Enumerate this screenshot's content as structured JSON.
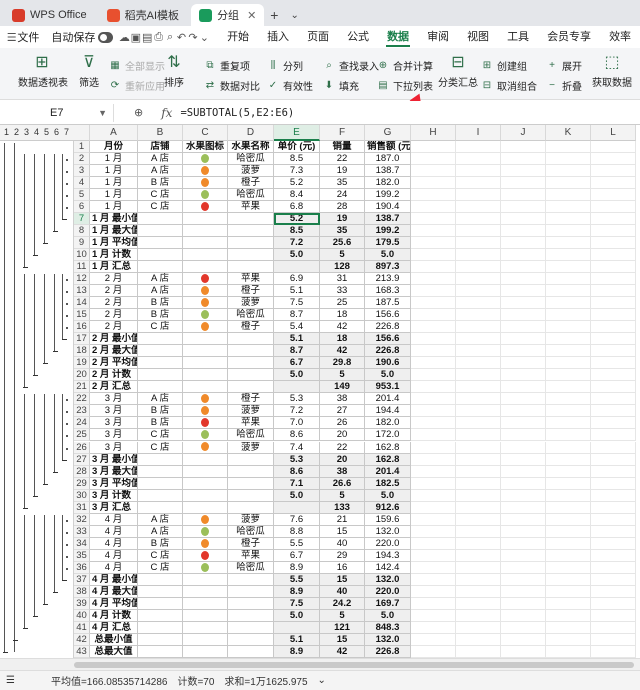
{
  "tabs": [
    {
      "label": "WPS Office",
      "color": "#d83b2a"
    },
    {
      "label": "稻壳AI模板",
      "color": "#e8502f"
    },
    {
      "label": "分组",
      "color": "#1a9b5c"
    }
  ],
  "menu": {
    "file": "文件",
    "autosave": "自动保存",
    "items": [
      "开始",
      "插入",
      "页面",
      "公式",
      "数据",
      "审阅",
      "视图",
      "工具",
      "会员专享",
      "效率"
    ],
    "active": "数据"
  },
  "ribbon": {
    "pivot": "数据透视表",
    "filter": "筛选",
    "show_all": "全部显示",
    "reapply": "重新应用",
    "sort": "排序",
    "duplicate": "重复项",
    "compare": "数据对比",
    "split": "分列",
    "validity": "有效性",
    "lookup": "查找录入",
    "fill": "填充",
    "consolidate": "合并计算",
    "dropdown": "下拉列表",
    "subtotal": "分类汇总",
    "group": "创建组",
    "ungroup": "取消组合",
    "expand": "展开",
    "collapse": "折叠",
    "get_data": "获取数据"
  },
  "formula_bar": {
    "cell": "E7",
    "fx": "fx",
    "formula": "=SUBTOTAL(5,E2:E6)"
  },
  "outline_levels": [
    "1",
    "2",
    "3",
    "4",
    "5",
    "6",
    "7"
  ],
  "columns": [
    "A",
    "B",
    "C",
    "D",
    "E",
    "F",
    "G",
    "H",
    "I",
    "J",
    "K",
    "L"
  ],
  "headers": [
    "月份",
    "店铺",
    "水果图标",
    "水果名称",
    "单价 (元)",
    "销量",
    "销售额 (元)"
  ],
  "rows": [
    {
      "n": "2",
      "type": "data",
      "a": "1 月",
      "b": "A 店",
      "fruit": "melon",
      "d": "哈密瓜",
      "e": "8.5",
      "f": "22",
      "g": "187.0"
    },
    {
      "n": "3",
      "type": "data",
      "a": "1 月",
      "b": "A 店",
      "fruit": "orange",
      "d": "菠萝",
      "e": "7.3",
      "f": "19",
      "g": "138.7"
    },
    {
      "n": "4",
      "type": "data",
      "a": "1 月",
      "b": "B 店",
      "fruit": "orange",
      "d": "橙子",
      "e": "5.2",
      "f": "35",
      "g": "182.0"
    },
    {
      "n": "5",
      "type": "data",
      "a": "1 月",
      "b": "C 店",
      "fruit": "melon",
      "d": "哈密瓜",
      "e": "8.4",
      "f": "24",
      "g": "199.2"
    },
    {
      "n": "6",
      "type": "data",
      "a": "1 月",
      "b": "C 店",
      "fruit": "apple",
      "d": "苹果",
      "e": "6.8",
      "f": "28",
      "g": "190.4"
    },
    {
      "n": "7",
      "type": "sum",
      "a": "1 月 最小值",
      "e": "5.2",
      "f": "19",
      "g": "138.7"
    },
    {
      "n": "8",
      "type": "sum",
      "a": "1 月 最大值",
      "e": "8.5",
      "f": "35",
      "g": "199.2"
    },
    {
      "n": "9",
      "type": "sum",
      "a": "1 月 平均值",
      "e": "7.2",
      "f": "25.6",
      "g": "179.5"
    },
    {
      "n": "10",
      "type": "sum",
      "a": "1 月 计数",
      "e": "5.0",
      "f": "5",
      "g": "5.0"
    },
    {
      "n": "11",
      "type": "sum",
      "a": "1 月 汇总",
      "e": "",
      "f": "128",
      "g": "897.3"
    },
    {
      "n": "12",
      "type": "data",
      "a": "2 月",
      "b": "A 店",
      "fruit": "apple",
      "d": "苹果",
      "e": "6.9",
      "f": "31",
      "g": "213.9"
    },
    {
      "n": "13",
      "type": "data",
      "a": "2 月",
      "b": "A 店",
      "fruit": "orange",
      "d": "橙子",
      "e": "5.1",
      "f": "33",
      "g": "168.3"
    },
    {
      "n": "14",
      "type": "data",
      "a": "2 月",
      "b": "B 店",
      "fruit": "orange",
      "d": "菠萝",
      "e": "7.5",
      "f": "25",
      "g": "187.5"
    },
    {
      "n": "15",
      "type": "data",
      "a": "2 月",
      "b": "B 店",
      "fruit": "melon",
      "d": "哈密瓜",
      "e": "8.7",
      "f": "18",
      "g": "156.6"
    },
    {
      "n": "16",
      "type": "data",
      "a": "2 月",
      "b": "C 店",
      "fruit": "orange",
      "d": "橙子",
      "e": "5.4",
      "f": "42",
      "g": "226.8"
    },
    {
      "n": "17",
      "type": "sum",
      "a": "2 月 最小值",
      "e": "5.1",
      "f": "18",
      "g": "156.6"
    },
    {
      "n": "18",
      "type": "sum",
      "a": "2 月 最大值",
      "e": "8.7",
      "f": "42",
      "g": "226.8"
    },
    {
      "n": "19",
      "type": "sum",
      "a": "2 月 平均值",
      "e": "6.7",
      "f": "29.8",
      "g": "190.6"
    },
    {
      "n": "20",
      "type": "sum",
      "a": "2 月 计数",
      "e": "5.0",
      "f": "5",
      "g": "5.0"
    },
    {
      "n": "21",
      "type": "sum",
      "a": "2 月 汇总",
      "e": "",
      "f": "149",
      "g": "953.1"
    },
    {
      "n": "22",
      "type": "data",
      "a": "3 月",
      "b": "A 店",
      "fruit": "orange",
      "d": "橙子",
      "e": "5.3",
      "f": "38",
      "g": "201.4"
    },
    {
      "n": "23",
      "type": "data",
      "a": "3 月",
      "b": "B 店",
      "fruit": "orange",
      "d": "菠萝",
      "e": "7.2",
      "f": "27",
      "g": "194.4"
    },
    {
      "n": "24",
      "type": "data",
      "a": "3 月",
      "b": "B 店",
      "fruit": "apple",
      "d": "苹果",
      "e": "7.0",
      "f": "26",
      "g": "182.0"
    },
    {
      "n": "25",
      "type": "data",
      "a": "3 月",
      "b": "C 店",
      "fruit": "melon",
      "d": "哈密瓜",
      "e": "8.6",
      "f": "20",
      "g": "172.0"
    },
    {
      "n": "26",
      "type": "data",
      "a": "3 月",
      "b": "C 店",
      "fruit": "orange",
      "d": "菠萝",
      "e": "7.4",
      "f": "22",
      "g": "162.8"
    },
    {
      "n": "27",
      "type": "sum",
      "a": "3 月 最小值",
      "e": "5.3",
      "f": "20",
      "g": "162.8"
    },
    {
      "n": "28",
      "type": "sum",
      "a": "3 月 最大值",
      "e": "8.6",
      "f": "38",
      "g": "201.4"
    },
    {
      "n": "29",
      "type": "sum",
      "a": "3 月 平均值",
      "e": "7.1",
      "f": "26.6",
      "g": "182.5"
    },
    {
      "n": "30",
      "type": "sum",
      "a": "3 月 计数",
      "e": "5.0",
      "f": "5",
      "g": "5.0"
    },
    {
      "n": "31",
      "type": "sum",
      "a": "3 月 汇总",
      "e": "",
      "f": "133",
      "g": "912.6"
    },
    {
      "n": "32",
      "type": "data",
      "a": "4 月",
      "b": "A 店",
      "fruit": "orange",
      "d": "菠萝",
      "e": "7.6",
      "f": "21",
      "g": "159.6"
    },
    {
      "n": "33",
      "type": "data",
      "a": "4 月",
      "b": "A 店",
      "fruit": "melon",
      "d": "哈密瓜",
      "e": "8.8",
      "f": "15",
      "g": "132.0"
    },
    {
      "n": "34",
      "type": "data",
      "a": "4 月",
      "b": "B 店",
      "fruit": "orange",
      "d": "橙子",
      "e": "5.5",
      "f": "40",
      "g": "220.0"
    },
    {
      "n": "35",
      "type": "data",
      "a": "4 月",
      "b": "C 店",
      "fruit": "apple",
      "d": "苹果",
      "e": "6.7",
      "f": "29",
      "g": "194.3"
    },
    {
      "n": "36",
      "type": "data",
      "a": "4 月",
      "b": "C 店",
      "fruit": "melon",
      "d": "哈密瓜",
      "e": "8.9",
      "f": "16",
      "g": "142.4"
    },
    {
      "n": "37",
      "type": "sum",
      "a": "4 月 最小值",
      "e": "5.5",
      "f": "15",
      "g": "132.0"
    },
    {
      "n": "38",
      "type": "sum",
      "a": "4 月 最大值",
      "e": "8.9",
      "f": "40",
      "g": "220.0"
    },
    {
      "n": "39",
      "type": "sum",
      "a": "4 月 平均值",
      "e": "7.5",
      "f": "24.2",
      "g": "169.7"
    },
    {
      "n": "40",
      "type": "sum",
      "a": "4 月 计数",
      "e": "5.0",
      "f": "5",
      "g": "5.0"
    },
    {
      "n": "41",
      "type": "sum",
      "a": "4 月 汇总",
      "e": "",
      "f": "121",
      "g": "848.3"
    },
    {
      "n": "42",
      "type": "total",
      "a": "总最小值",
      "e": "5.1",
      "f": "15",
      "g": "132.0"
    },
    {
      "n": "43",
      "type": "total",
      "a": "总最大值",
      "e": "8.9",
      "f": "42",
      "g": "226.8"
    }
  ],
  "fruit_colors": {
    "melon": "#9bbf5a",
    "orange": "#f08a2a",
    "apple": "#e2372b"
  },
  "status": {
    "avg": "平均值=166.08535714286",
    "count": "计数=70",
    "sum": "求和=1万1625.975"
  },
  "accent": "#1a7f4b"
}
